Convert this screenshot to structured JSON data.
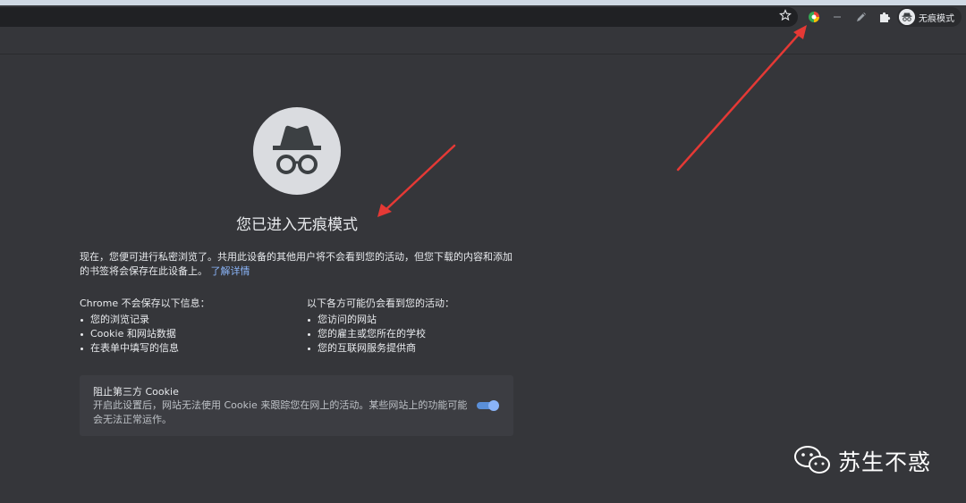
{
  "toolbar": {
    "profile_label": "无痕模式",
    "icons": [
      "star-icon",
      "colorful-extension-icon",
      "dash-icon",
      "pen-extension-icon",
      "puzzle-icon",
      "incognito-avatar-icon"
    ]
  },
  "page": {
    "title": "您已进入无痕模式",
    "intro": "现在，您便可进行私密浏览了。共用此设备的其他用户将不会看到您的活动，但您下载的内容和添加的书签将会保存在此设备上。",
    "learn_more": "了解详情",
    "not_saved": {
      "heading": "Chrome 不会保存以下信息：",
      "items": [
        "您的浏览记录",
        "Cookie 和网站数据",
        "在表单中填写的信息"
      ]
    },
    "may_see": {
      "heading": "以下各方可能仍会看到您的活动：",
      "items": [
        "您访问的网站",
        "您的雇主或您所在的学校",
        "您的互联网服务提供商"
      ]
    },
    "cookie_card": {
      "title": "阻止第三方 Cookie",
      "description": "开启此设置后，网站无法使用 Cookie 来跟踪您在网上的活动。某些网站上的功能可能会无法正常运作。",
      "toggle_on": true
    }
  },
  "watermark": {
    "text": "苏生不惑"
  },
  "colors": {
    "background": "#35363a",
    "link": "#8ab4f8",
    "toggle": "#8ab4f8",
    "arrow": "#e53935"
  }
}
